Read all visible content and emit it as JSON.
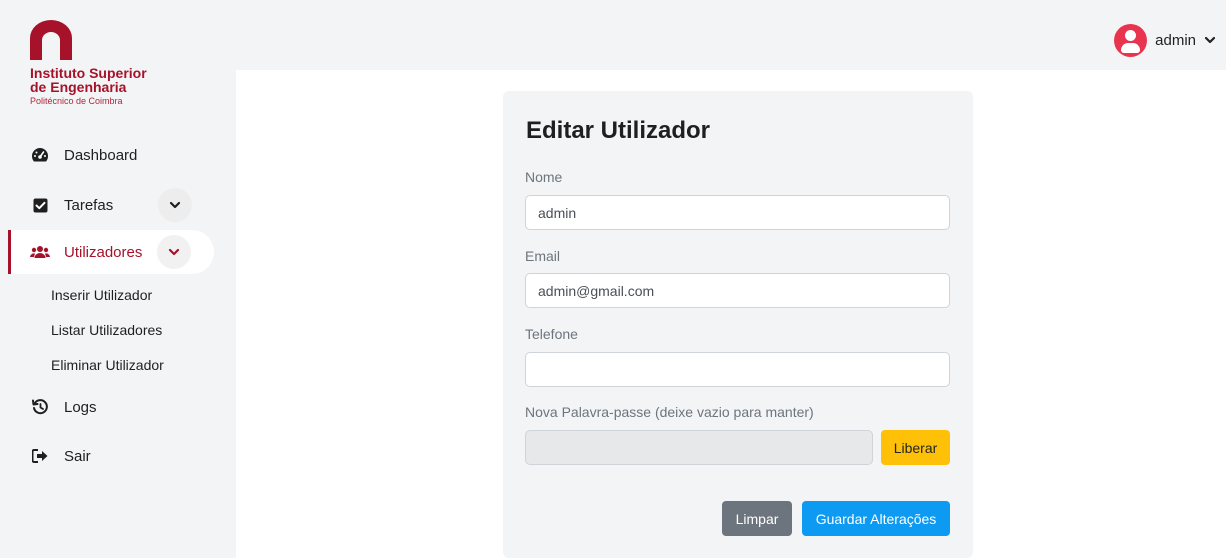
{
  "brand": {
    "name_line1": "Instituto Superior",
    "name_line2": "de Engenharia",
    "subtitle": "Politécnico de Coimbra",
    "color": "#a5122a"
  },
  "user": {
    "name": "admin",
    "avatar_icon": "user-circle-icon",
    "avatar_color": "#e8344e"
  },
  "sidebar": {
    "items": [
      {
        "label": "Dashboard",
        "icon": "gauge-icon"
      },
      {
        "label": "Tarefas",
        "icon": "check-square-icon",
        "expandable": true
      },
      {
        "label": "Utilizadores",
        "icon": "users-icon",
        "expandable": true,
        "active": true,
        "children": [
          "Inserir Utilizador",
          "Listar Utilizadores",
          "Eliminar Utilizador"
        ]
      },
      {
        "label": "Logs",
        "icon": "history-icon"
      },
      {
        "label": "Sair",
        "icon": "sign-out-icon"
      }
    ]
  },
  "form": {
    "title": "Editar Utilizador",
    "fields": {
      "nome": {
        "label": "Nome",
        "value": "admin"
      },
      "email": {
        "label": "Email",
        "value": "admin@gmail.com"
      },
      "telefone": {
        "label": "Telefone",
        "value": ""
      },
      "password": {
        "label": "Nova Palavra-passe (deixe vazio para manter)",
        "value": ""
      }
    },
    "unlock_label": "Liberar",
    "clear_label": "Limpar",
    "save_label": "Guardar Alterações"
  },
  "colors": {
    "accent": "#a5122a",
    "primary": "#0d9af2",
    "warning": "#ffc107",
    "secondary": "#6c757d"
  }
}
